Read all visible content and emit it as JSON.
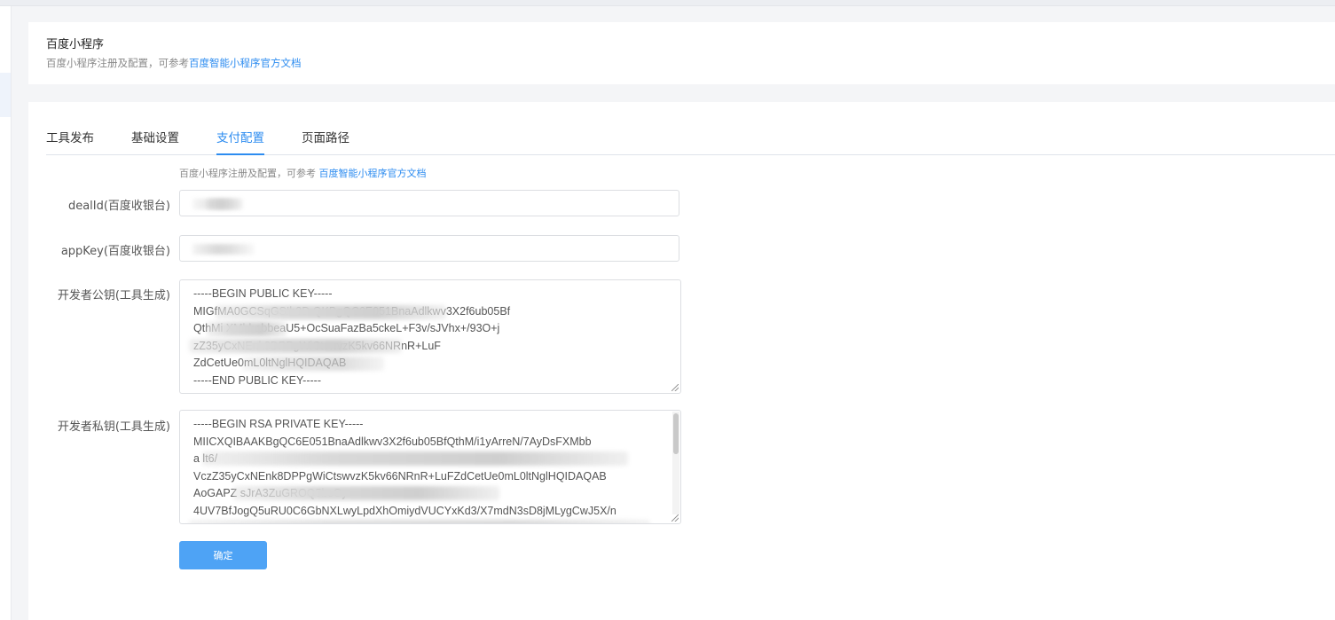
{
  "header": {
    "title": "百度小程序",
    "subtitle_prefix": "百度小程序注册及配置，可参考",
    "subtitle_link": "百度智能小程序官方文档"
  },
  "tabs": [
    {
      "label": "工具发布",
      "active": false
    },
    {
      "label": "基础设置",
      "active": false
    },
    {
      "label": "支付配置",
      "active": true
    },
    {
      "label": "页面路径",
      "active": false
    }
  ],
  "form": {
    "hint_prefix": "百度小程序注册及配置，可参考 ",
    "hint_link": "百度智能小程序官方文档",
    "dealid_label": "dealId(百度收银台)",
    "appkey_label": "appKey(百度收银台)",
    "public_key_label": "开发者公钥(工具生成)",
    "private_key_label": "开发者私钥(工具生成)",
    "public_key_lines": [
      "-----BEGIN PUBLIC KEY-----",
      "MIGfMA0GCSqGSIb3D                                     QKBgQC6E051BnaAdlkwv3X2f6ub05Bf",
      "QthMi       XMbbabbeaU5+OcSuaFazBa5ckeL+F3v/sJVhx+/93O+j",
      "                      zZ35yCxNEnk8DPPgWiCtswvzK5kv66NRnR+LuF",
      "ZdCetUe0mL0ltNglHQIDAQAB",
      "-----END PUBLIC KEY-----"
    ],
    "private_key_lines": [
      "-----BEGIN RSA PRIVATE KEY-----",
      "MIICXQIBAAKBgQC6E051BnaAdlkwv3X2f6ub05BfQthM/i1yArreN/7AyDsFXMbb",
      "a                                                                    lt6/",
      "VczZ35yCxNEnk8DPPgWiCtswvzK5kv66NRnR+LuFZdCetUe0mL0ltNglHQIDAQAB",
      "AoGAPZ                                                 sJrA3ZuGROQ5bsGy",
      "4UV7BfJogQ5uRU0C6GbNXLwyLpdXhOmiydVUCYxKd3/X7mdN3sD8jMLygCwJ5X/n",
      ""
    ],
    "submit_label": "确定"
  }
}
